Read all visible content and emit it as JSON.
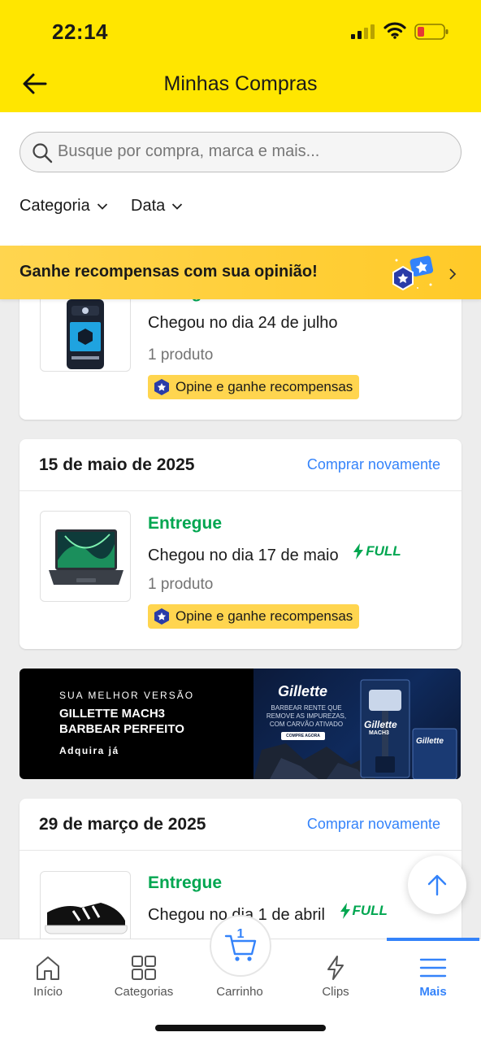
{
  "status_bar": {
    "time": "22:14"
  },
  "header": {
    "title": "Minhas Compras"
  },
  "search": {
    "placeholder": "Busque por compra, marca e mais..."
  },
  "filters": [
    {
      "label": "Categoria"
    },
    {
      "label": "Data"
    }
  ],
  "banner": {
    "text": "Ganhe recompensas com sua opinião!"
  },
  "orders": [
    {
      "date": "",
      "buy_again": "",
      "status": "Entregue",
      "arrived": "Chegou no dia 24 de julho",
      "full": false,
      "quantity": "1 produto",
      "review_label": "Opine e ganhe recompensas"
    },
    {
      "date": "15 de maio de 2025",
      "buy_again": "Comprar novamente",
      "status": "Entregue",
      "arrived": "Chegou no dia 17 de maio",
      "full": true,
      "full_label": "FULL",
      "quantity": "1 produto",
      "review_label": "Opine e ganhe recompensas"
    },
    {
      "date": "29 de março de 2025",
      "buy_again": "Comprar novamente",
      "status": "Entregue",
      "arrived": "Chegou no dia 1 de abril",
      "full": true,
      "full_label": "FULL"
    }
  ],
  "ad": {
    "kicker": "SUA MELHOR VERSÃO",
    "headline": "GILLETTE MACH3\nBARBEAR PERFEITO",
    "cta": "Adquira já",
    "brand": "Gillette",
    "sub": "BARBEAR RENTE QUE\nREMOVE AS IMPUREZAS,\nCOM CARVÃO ATIVADO",
    "button": "COMPRE AGORA",
    "pack_brand": "Gillette",
    "pack_name": "MACH3"
  },
  "tabbar": {
    "cart_count": "1",
    "items": [
      {
        "label": "Início",
        "icon": "home-icon"
      },
      {
        "label": "Categorias",
        "icon": "grid-icon"
      },
      {
        "label": "Carrinho",
        "icon": "cart-icon"
      },
      {
        "label": "Clips",
        "icon": "bolt-outline-icon"
      },
      {
        "label": "Mais",
        "icon": "menu-icon",
        "active": true
      }
    ]
  },
  "colors": {
    "header_yellow": "#ffe600",
    "accent_blue": "#3483fa",
    "success_green": "#00a650",
    "badge_yellow": "#ffd54f"
  }
}
